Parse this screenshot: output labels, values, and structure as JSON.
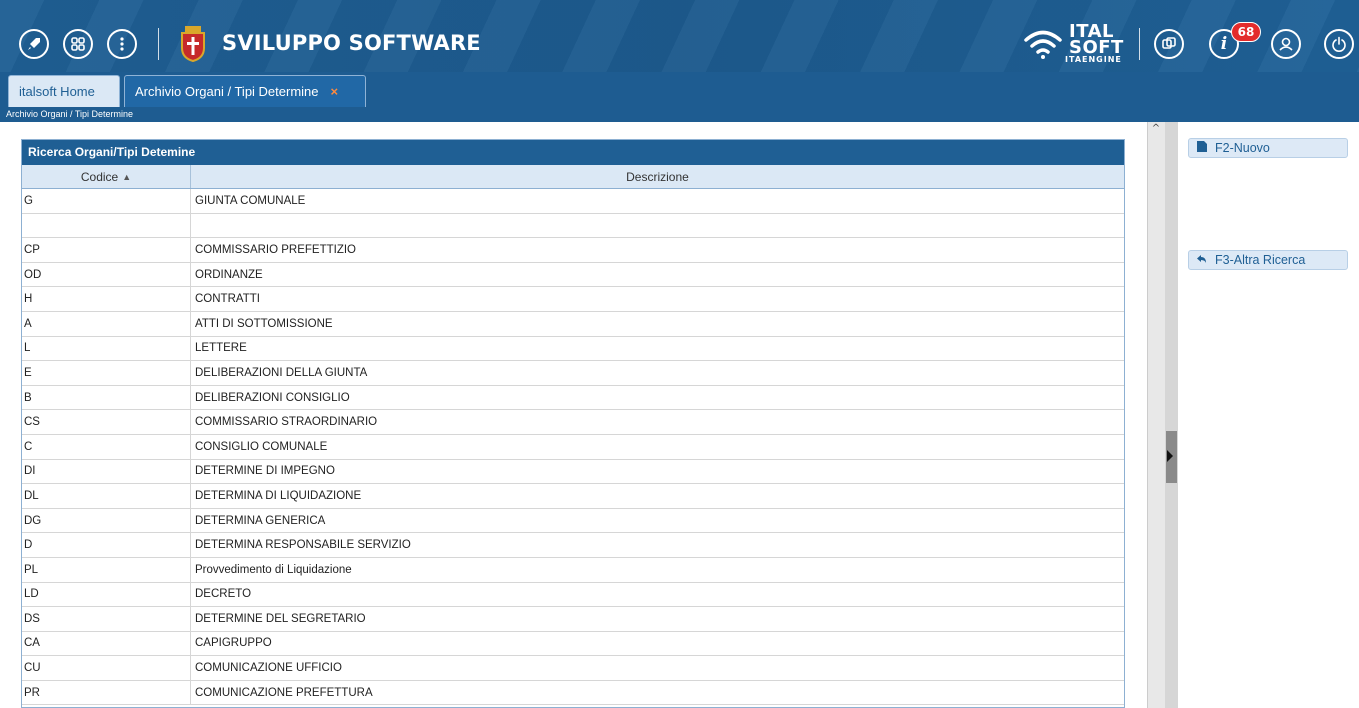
{
  "header": {
    "app_title": "SVILUPPO SOFTWARE",
    "logo_line1": "ITAL",
    "logo_line2": "SOFT",
    "logo_line3": "ITAENGINE",
    "notifications_count": "68",
    "icons": [
      "rocket-icon",
      "apps-grid-icon",
      "info-menu-icon",
      "windows-icon",
      "info-icon",
      "user-icon",
      "power-icon"
    ]
  },
  "tabs": [
    {
      "label": "italsoft Home"
    },
    {
      "label": "Archivio Organi / Tipi Determine",
      "close": "×"
    }
  ],
  "breadcrumb": "Archivio Organi / Tipi Determine",
  "grid": {
    "title": "Ricerca Organi/Tipi Detemine",
    "columns": [
      "Codice",
      "Descrizione"
    ],
    "rows": [
      {
        "codice": "G",
        "descrizione": "GIUNTA COMUNALE"
      },
      {
        "codice": "",
        "descrizione": ""
      },
      {
        "codice": "CP",
        "descrizione": "COMMISSARIO PREFETTIZIO"
      },
      {
        "codice": "OD",
        "descrizione": "ORDINANZE"
      },
      {
        "codice": "H",
        "descrizione": "CONTRATTI"
      },
      {
        "codice": "A",
        "descrizione": "ATTI DI SOTTOMISSIONE"
      },
      {
        "codice": "L",
        "descrizione": "LETTERE"
      },
      {
        "codice": "E",
        "descrizione": "DELIBERAZIONI DELLA GIUNTA"
      },
      {
        "codice": "B",
        "descrizione": "DELIBERAZIONI CONSIGLIO"
      },
      {
        "codice": "CS",
        "descrizione": "COMMISSARIO STRAORDINARIO"
      },
      {
        "codice": "C",
        "descrizione": "CONSIGLIO COMUNALE"
      },
      {
        "codice": "DI",
        "descrizione": "DETERMINE DI IMPEGNO"
      },
      {
        "codice": "DL",
        "descrizione": "DETERMINA DI LIQUIDAZIONE"
      },
      {
        "codice": "DG",
        "descrizione": "DETERMINA GENERICA"
      },
      {
        "codice": "D",
        "descrizione": "DETERMINA RESPONSABILE SERVIZIO"
      },
      {
        "codice": "PL",
        "descrizione": "Provvedimento di Liquidazione"
      },
      {
        "codice": "LD",
        "descrizione": "DECRETO"
      },
      {
        "codice": "DS",
        "descrizione": "DETERMINE DEL SEGRETARIO"
      },
      {
        "codice": "CA",
        "descrizione": "CAPIGRUPPO"
      },
      {
        "codice": "CU",
        "descrizione": "COMUNICAZIONE UFFICIO"
      },
      {
        "codice": "PR",
        "descrizione": "COMUNICAZIONE PREFETTURA"
      }
    ]
  },
  "actions": {
    "new_label": "F2-Nuovo",
    "other_search_label": "F3-Altra Ricerca"
  },
  "colors": {
    "primary": "#1f5f94",
    "badge": "#e32b2b",
    "close_tab": "#ff8a3d"
  }
}
